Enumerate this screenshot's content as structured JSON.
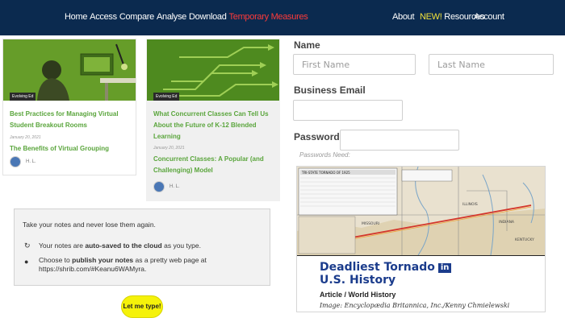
{
  "nav": {
    "left_items": [
      "Home",
      "Access",
      "Compare",
      "Analyse",
      "Download"
    ],
    "highlight_item": "Temporary Measures",
    "about": "About",
    "new_badge": "NEW!",
    "resources": "Resources",
    "account": "Account"
  },
  "cards": [
    {
      "tag": "Evolving Ed",
      "title": "Best Practices for Managing Virtual Student Breakout Rooms",
      "date": "January 20, 2021",
      "related_title": "The Benefits of Virtual Grouping",
      "author": "H. L."
    },
    {
      "tag": "Evolving Ed",
      "title": "What Concurrent Classes Can Tell Us About the Future of K-12 Blended Learning",
      "date": "January 20, 2021",
      "related_title": "Concurrent Classes: A Popular (and Challenging) Model",
      "author": "H. L."
    }
  ],
  "form": {
    "name_label": "Name",
    "first_name_placeholder": "First Name",
    "last_name_placeholder": "Last Name",
    "email_label": "Business Email",
    "password_label": "Password",
    "password_hint": "Passwords Need:"
  },
  "ad": {
    "headline": "Deadliest Tornado",
    "headline2": "U.S. History",
    "badge": "in",
    "subtitle": "Article / World History",
    "credit": "Image: Encyclopædia Britannica, Inc./Kenny Chmielewski",
    "map_title": "TRI-STATE TORNADO OF 1925",
    "states": [
      "ILLINOIS",
      "INDIANA",
      "MISSOURI",
      "KENTUCKY"
    ]
  },
  "promo": {
    "title": "Take your notes and never lose them again.",
    "line1_pre": "Your notes are ",
    "line1_bold": "auto-saved to the cloud",
    "line1_post": " as you type.",
    "line2_pre": "Choose to ",
    "line2_bold": "publish your notes",
    "line2_post": " as a pretty web page at https://shrib.com/#Keanu6WAMyra.",
    "button": "Let me type!"
  },
  "colors": {
    "nav_bg": "#0b2a4f",
    "highlight": "#ff3a3a",
    "new_badge": "#f2e23a",
    "card_title": "#5aa53c",
    "button": "#f5f20a"
  }
}
